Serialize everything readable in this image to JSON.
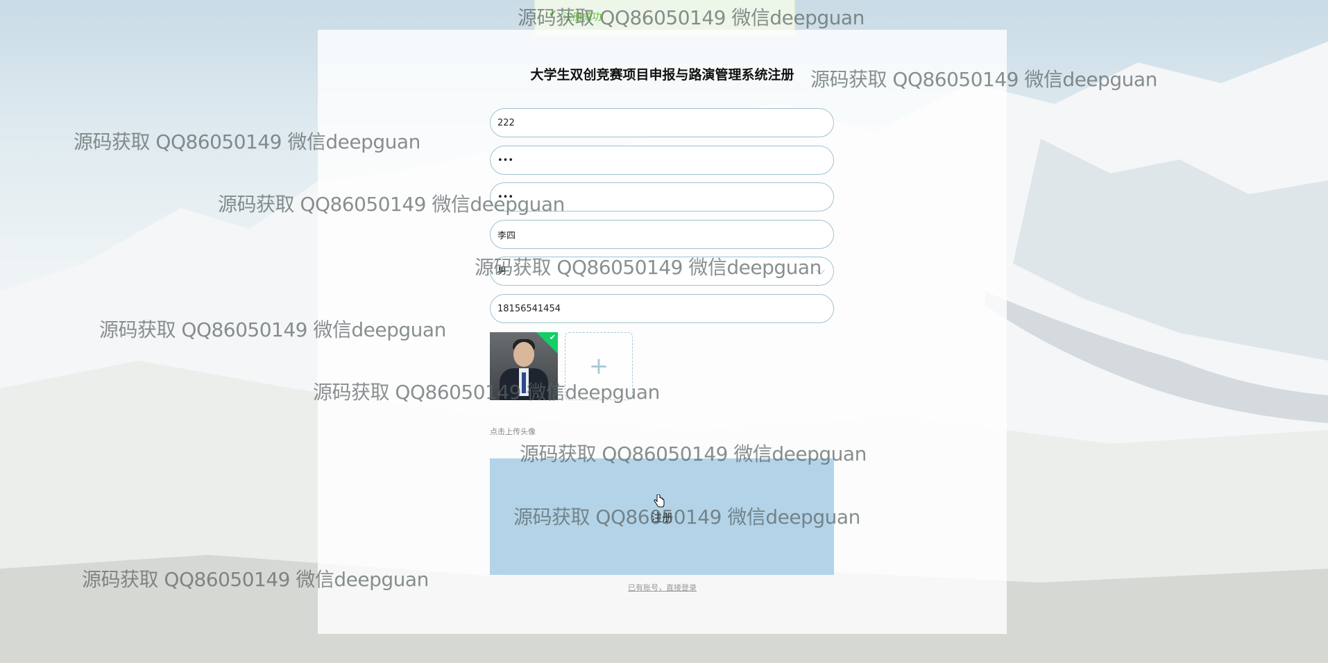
{
  "toast": {
    "icon": "check-icon",
    "message": "注册成功"
  },
  "form": {
    "title": "大学生双创竞赛项目申报与路演管理系统注册",
    "fields": [
      {
        "name": "username",
        "value": "222"
      },
      {
        "name": "password",
        "value": "•••"
      },
      {
        "name": "confirm_password",
        "value": "•••"
      },
      {
        "name": "real_name",
        "value": "李四"
      },
      {
        "name": "gender",
        "value": "男"
      },
      {
        "name": "phone",
        "value": "18156541454"
      }
    ],
    "upload_icon": "plus-icon",
    "upload_tip": "点击上传头像",
    "submit_label": "注册",
    "login_link": "已有账号，直接登录"
  },
  "watermark": {
    "text": "源码获取 QQ86050149 微信deepguan"
  },
  "colors": {
    "field_border": "#9cc3cf",
    "submit_bg": "#b3d4e8",
    "toast_green": "#67c23a",
    "avatar_badge": "#13ce66"
  }
}
